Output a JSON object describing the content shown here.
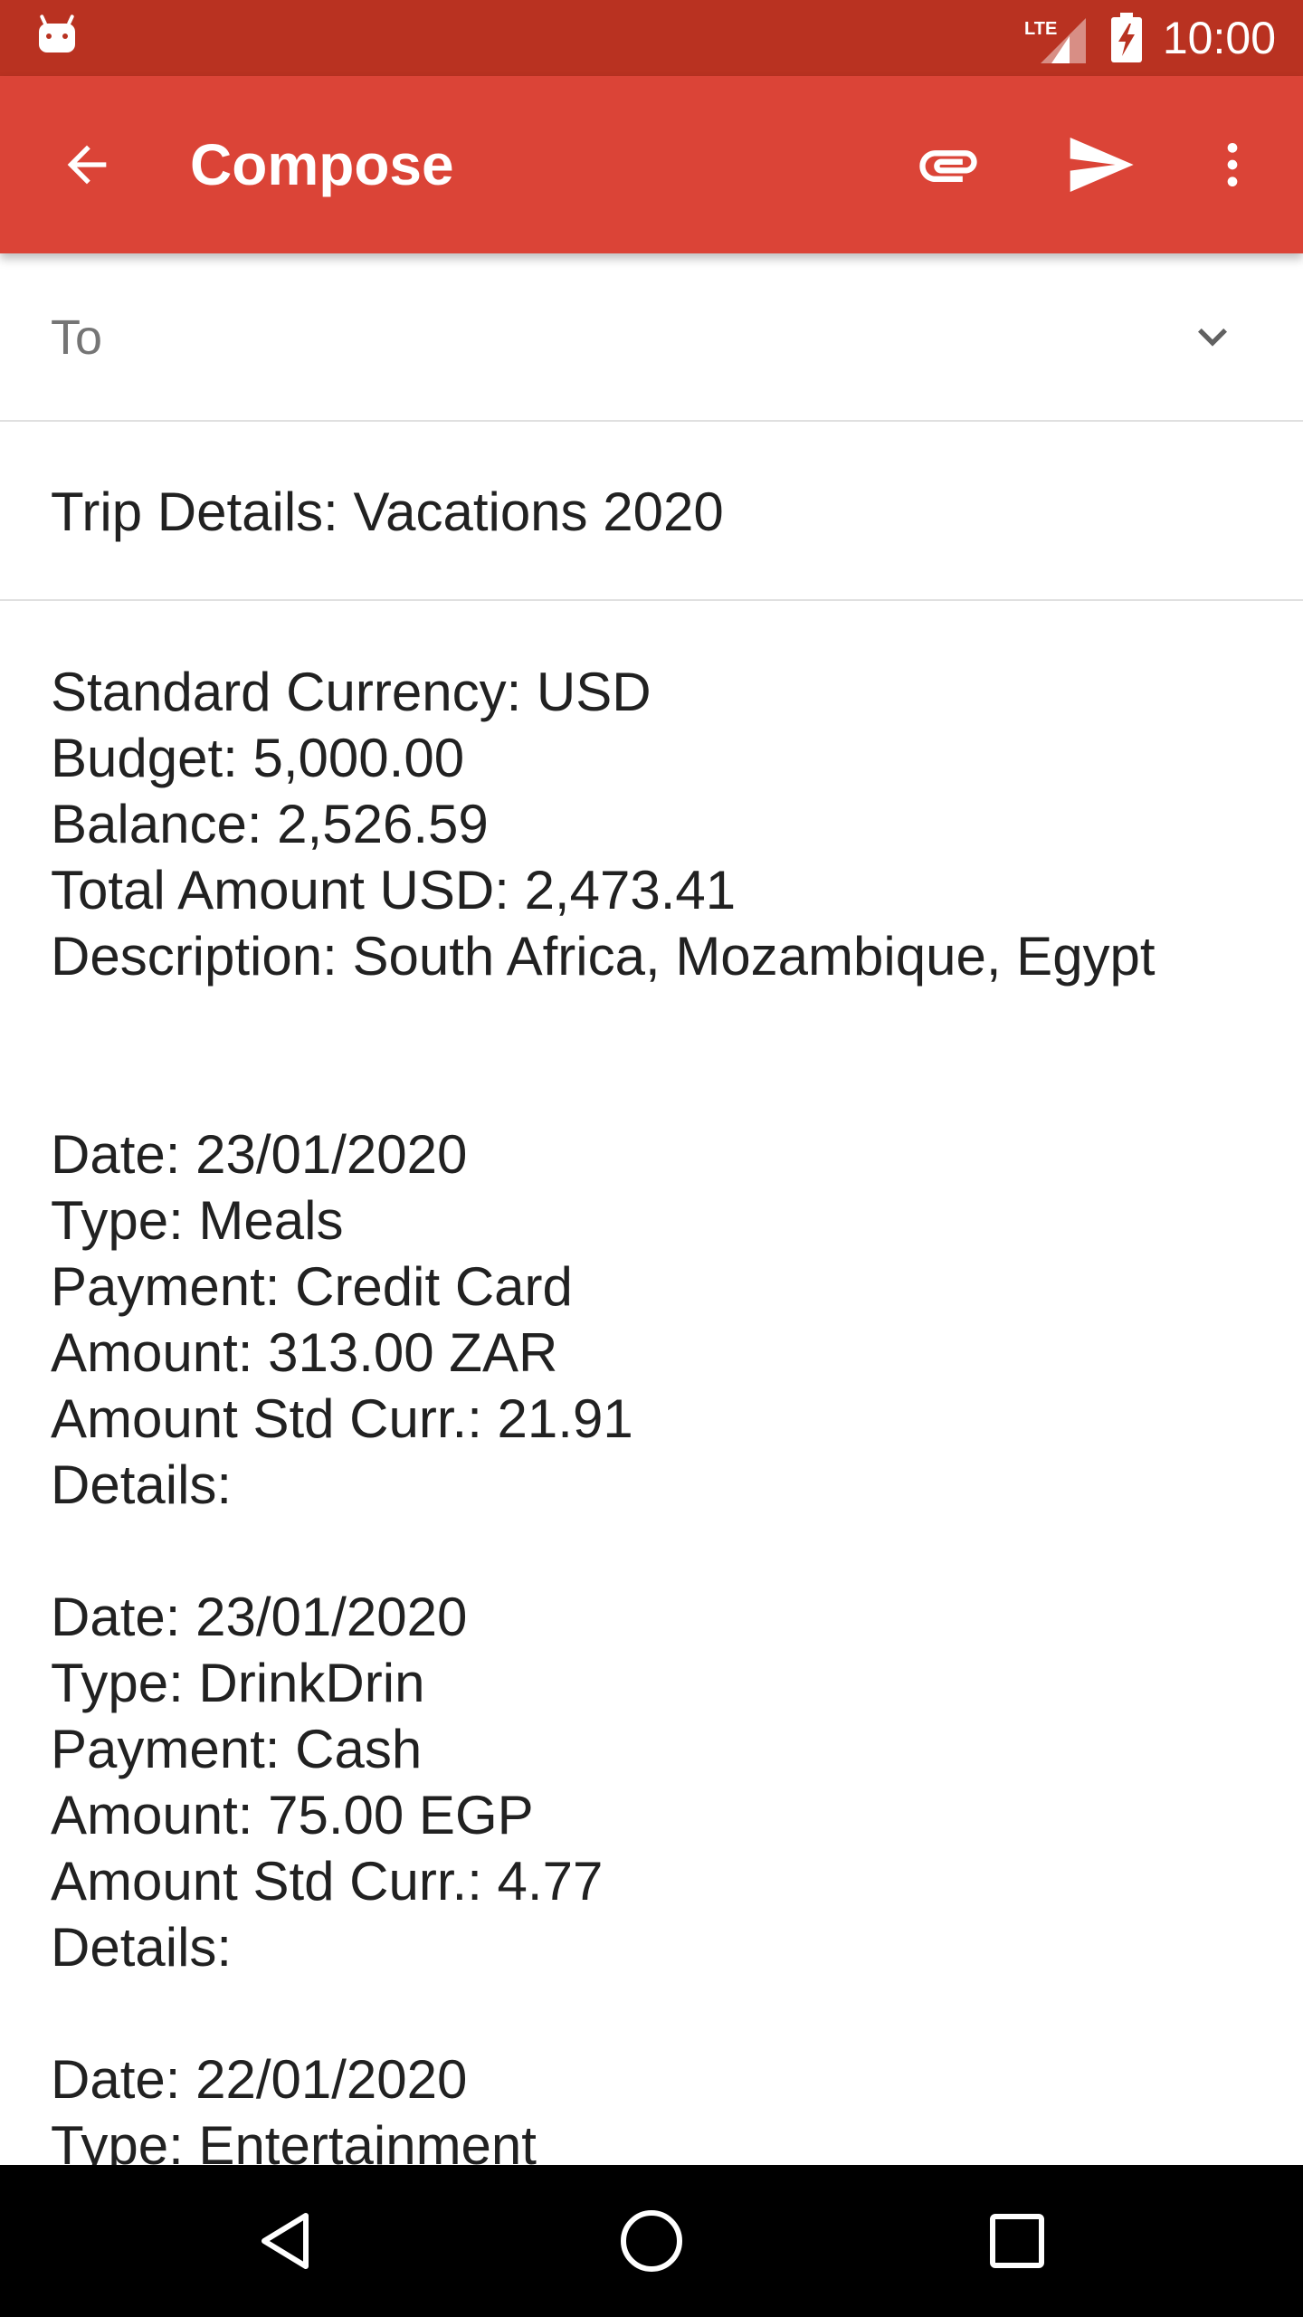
{
  "status_bar": {
    "time": "10:00",
    "network_label": "LTE",
    "icons": [
      "android-icon",
      "lte-signal-icon",
      "battery-charging-icon"
    ]
  },
  "app_bar": {
    "title": "Compose",
    "background_color": "#db4437",
    "status_color": "#b93221",
    "icons": [
      "back-arrow-icon",
      "paperclip-icon",
      "send-icon",
      "more-vert-icon"
    ]
  },
  "to_field": {
    "label": "To",
    "value": ""
  },
  "subject": {
    "value": "Trip Details: Vacations 2020"
  },
  "body": {
    "summary": [
      "Standard Currency: USD",
      "Budget: 5,000.00",
      "Balance: 2,526.59",
      "Total Amount USD: 2,473.41",
      "Description: South Africa, Mozambique, Egypt"
    ],
    "entries": [
      {
        "date": "Date: 23/01/2020",
        "type": "Type: Meals",
        "payment": "Payment: Credit Card",
        "amount": "Amount: 313.00 ZAR",
        "amount_std": "Amount Std Curr.: 21.91",
        "details": "Details:"
      },
      {
        "date": "Date: 23/01/2020",
        "type": "Type: DrinkDrin",
        "payment": "Payment: Cash",
        "amount": "Amount: 75.00 EGP",
        "amount_std": "Amount Std Curr.: 4.77",
        "details": "Details:"
      },
      {
        "date": "Date: 22/01/2020",
        "type": "Type: Entertainment"
      }
    ]
  },
  "nav_bar": {
    "icons": [
      "nav-back-icon",
      "nav-home-icon",
      "nav-recents-icon"
    ]
  }
}
